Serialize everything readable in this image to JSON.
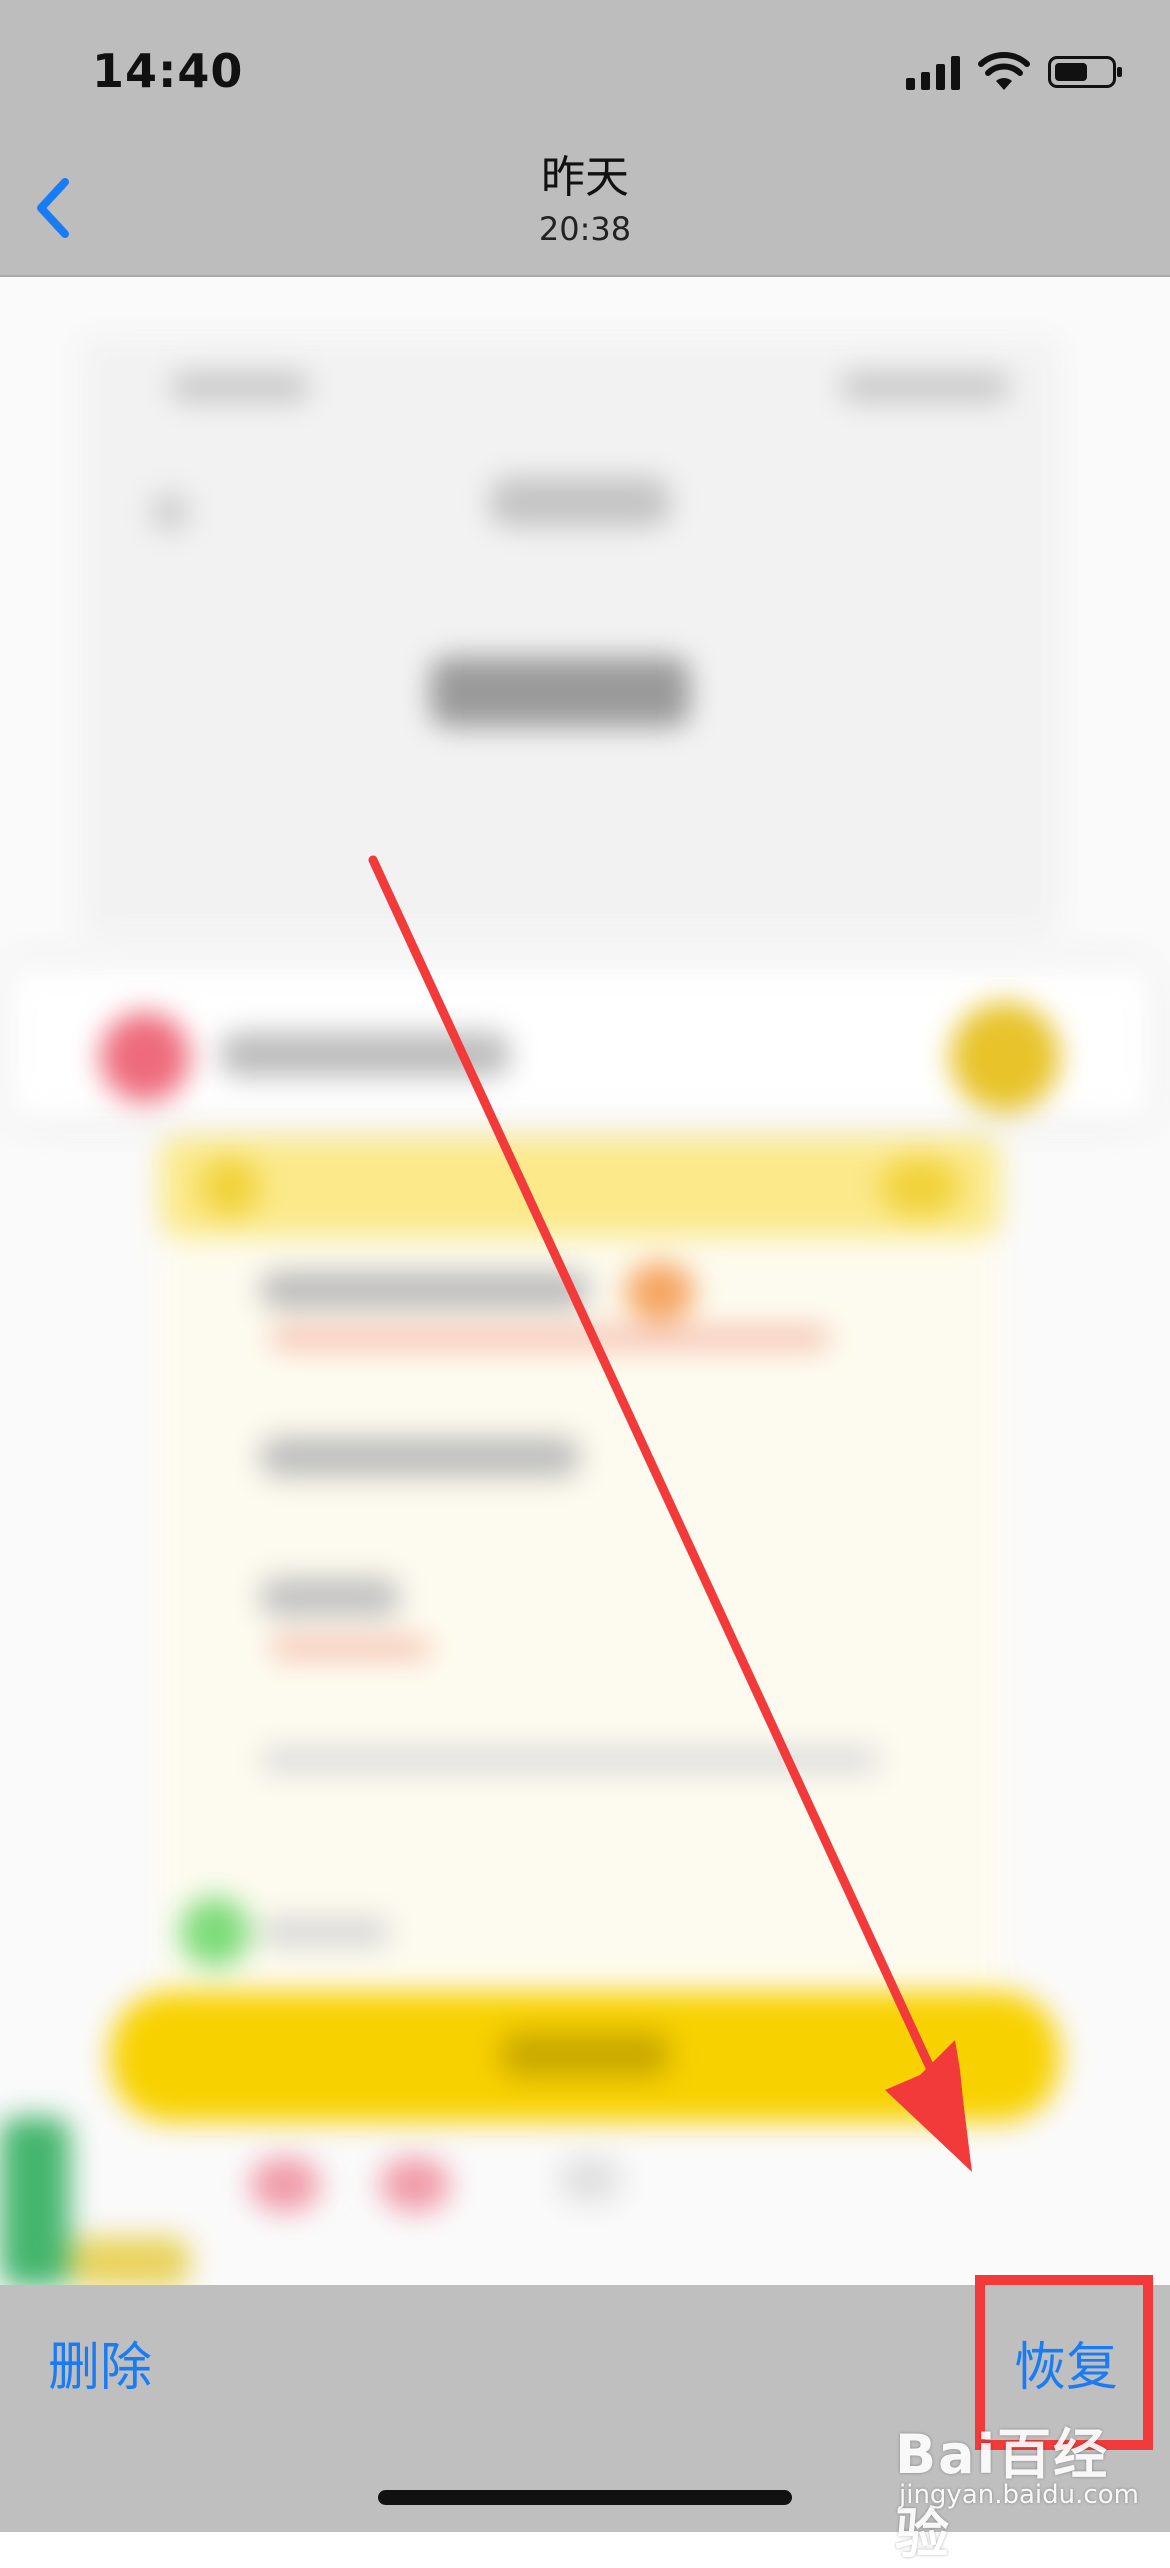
{
  "status_bar": {
    "time": "14:40"
  },
  "nav": {
    "title": "昨天",
    "subtitle": "20:38"
  },
  "toolbar": {
    "delete_label": "删除",
    "restore_label": "恢复"
  },
  "watermark": {
    "main": "Bai百经验",
    "sub": "jingyan.baidu.com"
  },
  "colors": {
    "accent": "#1a7cf5",
    "annotation_red": "#f23a3a",
    "header_gray": "#bdbdbd"
  },
  "icons": {
    "back": "chevron-left-icon",
    "signal": "cellular-signal-icon",
    "wifi": "wifi-icon",
    "battery": "battery-icon"
  }
}
